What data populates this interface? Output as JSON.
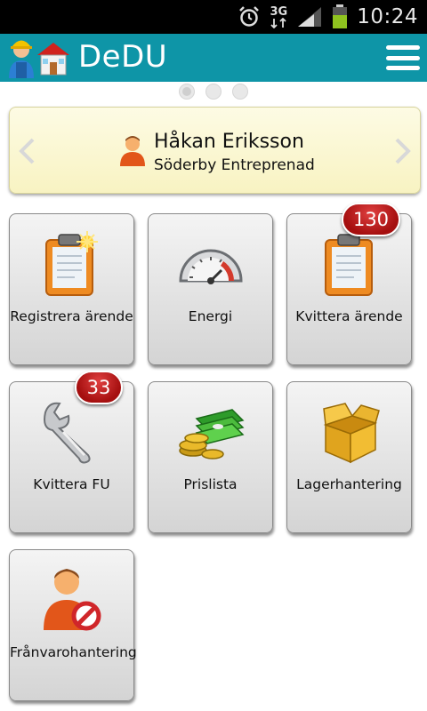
{
  "status_bar": {
    "time": "10:24",
    "network": "3G",
    "icons": [
      "alarm-icon",
      "network-3g-icon",
      "signal-icon",
      "battery-icon"
    ]
  },
  "app_bar": {
    "title": "DeDU",
    "color": "#0e95a7",
    "menu_icon": "hamburger-menu-icon"
  },
  "pager": {
    "pages": 3,
    "active_index": 0
  },
  "user_card": {
    "name": "Håkan Eriksson",
    "company": "Söderby Entreprenad"
  },
  "tiles": [
    {
      "label": "Registrera ärende",
      "icon": "clipboard-new-icon"
    },
    {
      "label": "Energi",
      "icon": "gauge-icon"
    },
    {
      "label": "Kvittera ärende",
      "icon": "clipboard-icon",
      "badge": "130"
    },
    {
      "label": "Kvittera FU",
      "icon": "wrench-icon",
      "badge": "33"
    },
    {
      "label": "Prislista",
      "icon": "money-icon"
    },
    {
      "label": "Lagerhantering",
      "icon": "box-icon"
    },
    {
      "label": "Frånvarohantering",
      "icon": "user-absence-icon"
    }
  ],
  "badge_color": "#c41a1a"
}
